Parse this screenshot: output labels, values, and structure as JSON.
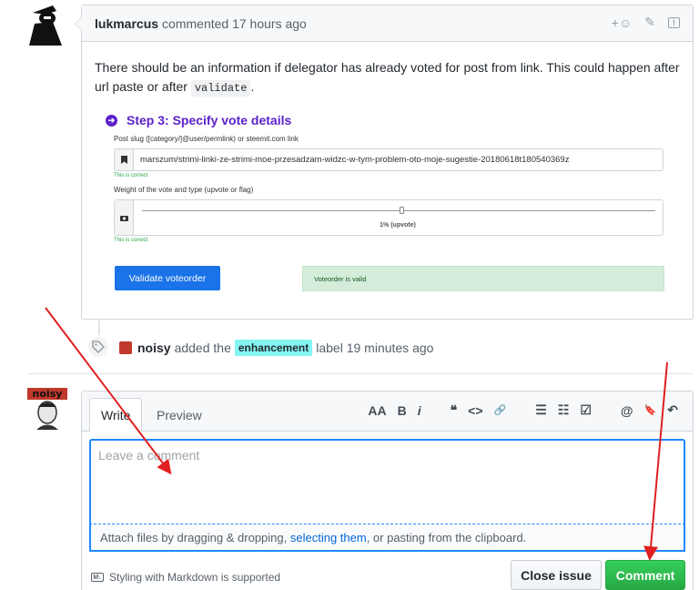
{
  "comment": {
    "author": "lukmarcus",
    "meta": "commented 17 hours ago",
    "body_text": "There should be an information if delegator has already voted for post from link. This could happen after url paste or after",
    "body_code": "validate",
    "body_end": ".",
    "actions": {
      "reaction": "+☺",
      "edit": "✎",
      "report": "!"
    }
  },
  "embed": {
    "step_icon": "➔",
    "step_title": "Step 3: Specify vote details",
    "slug_label": "Post slug ([category/]@user/permlink) or steemit.com link",
    "slug_value": "marszum/strimi-linki-ze-strimi-moe-przesadzam-widzc-w-tym-problem-oto-moje-sugestie-20180618t180540369z",
    "slug_valid": "This is correct",
    "weight_label": "Weight of the vote and type (upvote or flag)",
    "weight_value": "1% (upvote)",
    "weight_valid": "This is correct",
    "validate_button": "Validate voteorder",
    "valid_alert": "Voteorder is valid",
    "weight_fraction": 0.01
  },
  "event": {
    "actor": "noisy",
    "pre": "added the",
    "label": "enhancement",
    "post": "label 19 minutes ago"
  },
  "form": {
    "tab_write": "Write",
    "tab_preview": "Preview",
    "toolbar": [
      "AA",
      "B",
      "i",
      "❝",
      "<>",
      "🔗",
      "☰",
      "☷",
      "☑",
      "@",
      "🔖",
      "↶"
    ],
    "placeholder": "Leave a comment",
    "attach_pre": "Attach files by dragging & dropping,",
    "attach_link": "selecting them",
    "attach_post": ", or pasting from the clipboard.",
    "markdown_note": "Styling with Markdown is supported",
    "markdown_icon": "M↓",
    "close_button": "Close issue",
    "comment_button": "Comment"
  },
  "avatar_bottom_text": "noisy",
  "colors": {
    "accent_blue": "#2188ff",
    "comment_green": "#28a745",
    "label_cyan": "#84f5f3",
    "step_purple": "#5c21c9",
    "annotation_red": "#e02020"
  }
}
